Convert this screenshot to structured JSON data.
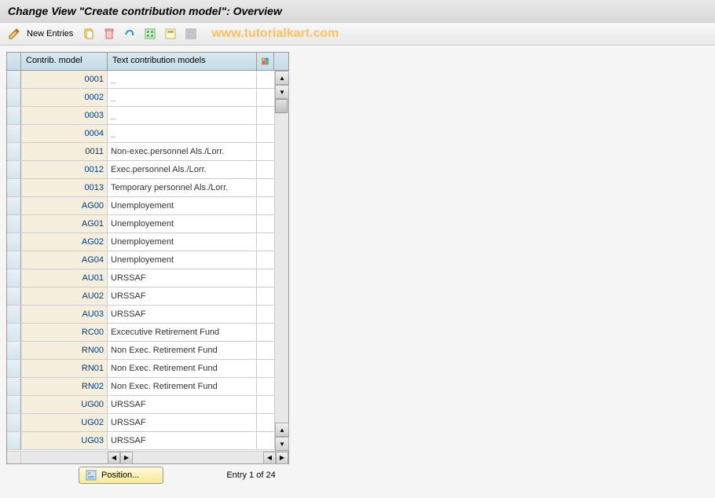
{
  "title": "Change View \"Create contribution model\": Overview",
  "toolbar": {
    "new_entries_label": "New Entries"
  },
  "watermark": "www.tutorialkart.com",
  "table": {
    "headers": {
      "model": "Contrib. model",
      "text": "Text contribution models"
    },
    "rows": [
      {
        "model": "0001",
        "text": ""
      },
      {
        "model": "0002",
        "text": ""
      },
      {
        "model": "0003",
        "text": ""
      },
      {
        "model": "0004",
        "text": ""
      },
      {
        "model": "0011",
        "text": "Non-exec.personnel Als./Lorr."
      },
      {
        "model": "0012",
        "text": "Exec.personnel Als./Lorr."
      },
      {
        "model": "0013",
        "text": "Temporary personnel Als./Lorr."
      },
      {
        "model": "AG00",
        "text": "Unemployement"
      },
      {
        "model": "AG01",
        "text": "Unemployement"
      },
      {
        "model": "AG02",
        "text": "Unemployement"
      },
      {
        "model": "AG04",
        "text": "Unemployement"
      },
      {
        "model": "AU01",
        "text": "URSSAF"
      },
      {
        "model": "AU02",
        "text": "URSSAF"
      },
      {
        "model": "AU03",
        "text": "URSSAF"
      },
      {
        "model": "RC00",
        "text": "Excecutive Retirement Fund"
      },
      {
        "model": "RN00",
        "text": "Non Exec. Retirement Fund"
      },
      {
        "model": "RN01",
        "text": "Non Exec. Retirement Fund"
      },
      {
        "model": "RN02",
        "text": "Non Exec. Retirement Fund"
      },
      {
        "model": "UG00",
        "text": "URSSAF"
      },
      {
        "model": "UG02",
        "text": "URSSAF"
      },
      {
        "model": "UG03",
        "text": "URSSAF"
      }
    ]
  },
  "footer": {
    "position_label": "Position...",
    "entry_counter": "Entry 1 of 24"
  }
}
